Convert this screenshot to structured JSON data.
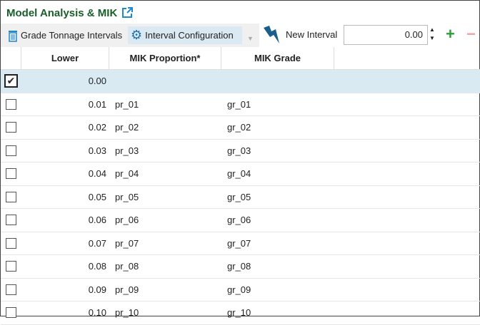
{
  "title": "Model Analysis & MIK",
  "toolbar": {
    "grade_tonnage": "Grade Tonnage Intervals",
    "interval_config": "Interval Configuration",
    "new_interval_label": "New Interval",
    "new_interval_value": "0.00"
  },
  "columns": [
    "Lower",
    "MIK Proportion*",
    "MIK Grade"
  ],
  "rows": [
    {
      "checked": true,
      "lower": "0.00",
      "prop": "",
      "grade": ""
    },
    {
      "checked": false,
      "lower": "0.01",
      "prop": "pr_01",
      "grade": "gr_01"
    },
    {
      "checked": false,
      "lower": "0.02",
      "prop": "pr_02",
      "grade": "gr_02"
    },
    {
      "checked": false,
      "lower": "0.03",
      "prop": "pr_03",
      "grade": "gr_03"
    },
    {
      "checked": false,
      "lower": "0.04",
      "prop": "pr_04",
      "grade": "gr_04"
    },
    {
      "checked": false,
      "lower": "0.05",
      "prop": "pr_05",
      "grade": "gr_05"
    },
    {
      "checked": false,
      "lower": "0.06",
      "prop": "pr_06",
      "grade": "gr_06"
    },
    {
      "checked": false,
      "lower": "0.07",
      "prop": "pr_07",
      "grade": "gr_07"
    },
    {
      "checked": false,
      "lower": "0.08",
      "prop": "pr_08",
      "grade": "gr_08"
    },
    {
      "checked": false,
      "lower": "0.09",
      "prop": "pr_09",
      "grade": "gr_09"
    },
    {
      "checked": false,
      "lower": "0.10",
      "prop": "pr_10",
      "grade": "gr_10"
    }
  ]
}
